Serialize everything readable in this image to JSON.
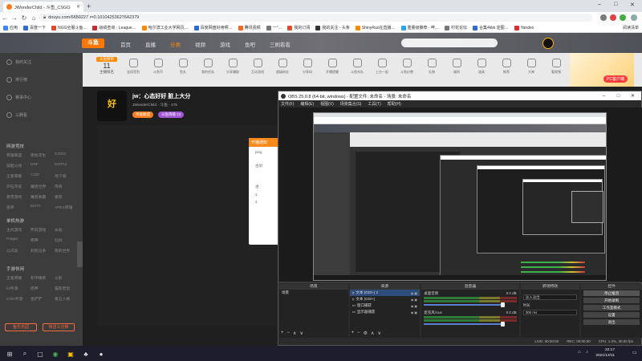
{
  "browser": {
    "tab_title": "JWonderChild - 斗鱼_CSGO",
    "window_controls": [
      "–",
      "□",
      "✕"
    ],
    "url": "douyu.com/6650227 r=0.10104253627642379",
    "bookmarks": [
      {
        "label": "应用",
        "color": "#4285f4"
      },
      {
        "label": "百度一下",
        "color": "#2e6ad0"
      },
      {
        "label": "NGG全服斗鱼…",
        "color": "#e04b2c"
      },
      {
        "label": "战绩查询 - League…",
        "color": "#c52e2e"
      },
      {
        "label": "哈尔滨工业大学网页…",
        "color": "#ff8a00"
      },
      {
        "label": "百度网盘好用啊…",
        "color": "#2e6ad0"
      },
      {
        "label": "腾讯视频",
        "color": "#f06a24"
      },
      {
        "label": "一\"…",
        "color": "#777777"
      },
      {
        "label": "我的订阅",
        "color": "#e04b2c"
      },
      {
        "label": "我的关注 - 头条",
        "color": "#333333"
      },
      {
        "label": "ShinyRuo在直播…",
        "color": "#ff8a00"
      },
      {
        "label": "重量级推荐 - 哔…",
        "color": "#2aa4f4"
      },
      {
        "label": "村花论坛",
        "color": "#777777"
      },
      {
        "label": "合集4kkk 逆图…",
        "color": "#2e6ad0"
      },
      {
        "label": "Yandex",
        "color": "#e02c2c"
      }
    ],
    "bookmarks_right": "阅读清单"
  },
  "douyu": {
    "logo": "斗鱼",
    "nav": [
      "首页",
      "直播",
      "分类",
      "视频",
      "游戏",
      "鱼吧",
      "三刷看看"
    ],
    "active_nav": 2,
    "sidebar": {
      "top_items": [
        "我的关注",
        "排行榜",
        "赛事中心",
        "三刷看"
      ],
      "section1": "网游竞技",
      "grid1": [
        "英雄联盟",
        "绝地求生",
        "CSGO",
        "穿越火线",
        "DNF",
        "DOTA2",
        "王者荣耀",
        "COD",
        "地下城",
        "炉石传说",
        "魔兽世界",
        "传奇",
        "暴雪游戏",
        "魔兽争霸",
        "星际",
        "巫师",
        "DOTA",
        "APEX英雄"
      ],
      "section2": "单机热游",
      "grid2": [
        "主机游戏",
        "怀旧游戏",
        "永劫",
        "Peppa",
        "原神",
        "仙剑",
        "以闪亮",
        "刺客信条",
        "我的世界"
      ],
      "section3": "手游休闲",
      "grid3": [
        "王者荣耀",
        "和平精英",
        "火影",
        "lol手游",
        "原神",
        "猫和老鼠",
        "COD手游",
        "金铲铲",
        "第五人格"
      ],
      "buttons": [
        "鱼乐乐园",
        "快活三分钟"
      ]
    },
    "toolbar": {
      "rank_tag": "斗鱼榜单",
      "rank_num": "11",
      "rank_sub": "主播排名",
      "items": [
        "连续签到",
        "斗鱼币",
        "鱼丸",
        "我的任务",
        "分享赚取",
        "互动游戏",
        "超级粉丝",
        "分享码",
        "开播提醒",
        "斗鱼车队",
        "上分一起",
        "斗鱼幻兽",
        "礼物",
        "福利",
        "道具",
        "推荐",
        "大神",
        "看视频",
        "关注"
      ],
      "promo": "PC客户端"
    },
    "streamer": {
      "avatar_text": "好",
      "title": "jw：心态好好 脏上大分",
      "meta": "JWonderChild · 斗鱼 · 47k",
      "chip1": "英雄联盟",
      "chip2": "斗鱼等级 13",
      "notice_title": "开播通知",
      "notice_lines": [
        "ping",
        "",
        "古剑",
        "",
        "",
        "进",
        "1.",
        "2."
      ]
    }
  },
  "obs": {
    "title": "OBS 25.0.8 (64-bit, windows) - 配置文件: 未命名 - 场景: 未命名",
    "menu": [
      "文件(F)",
      "编辑(E)",
      "视图(V)",
      "场景集合(S)",
      "工具(T)",
      "帮助(H)"
    ],
    "docks": {
      "scenes": "场景",
      "sources": "来源",
      "mixer": "混音器",
      "transitions": "转场特效",
      "controls": "控件"
    },
    "scene_items": [
      "场景"
    ],
    "source_items": [
      "文本 (GDI+) 2",
      "文本 (GDI+)",
      "窗口捕获",
      "显示器捕获"
    ],
    "mixer_items": [
      {
        "name": "桌面音频",
        "db": "0.0 dB"
      },
      {
        "name": "麦克风/Aux",
        "db": "0.0 dB"
      }
    ],
    "transition": {
      "type": "淡入淡出",
      "duration_label": "时长",
      "duration": "300 ms"
    },
    "controls": [
      "停止推流",
      "开始录制",
      "工作室模式",
      "设置",
      "退出"
    ],
    "status": [
      "LIVE: 00:00:00",
      "REC: 00:00:00",
      "CPU: 1.3%, 30.00 fps"
    ]
  },
  "taskbar": {
    "time": "22:17",
    "date": "2021/12/11",
    "apps": [
      "⊞",
      "⌕",
      "▢",
      "◉",
      "▣",
      "♣",
      "●"
    ]
  }
}
